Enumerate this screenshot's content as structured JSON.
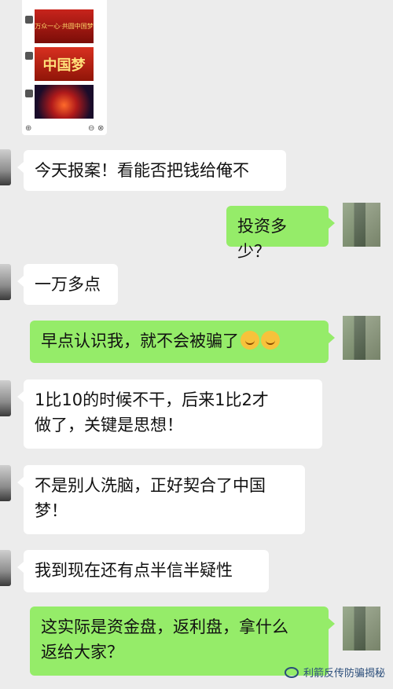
{
  "card": {
    "thumb1_text": "万众一心·共圆中国梦",
    "thumb2_text": "中国梦"
  },
  "messages": [
    {
      "side": "left",
      "text": "今天报案！看能否把钱给俺不"
    },
    {
      "side": "right",
      "text": "投资多少？"
    },
    {
      "side": "left",
      "text": "一万多点"
    },
    {
      "side": "right",
      "text": "早点认识我，就不会被骗了",
      "emojis": [
        "crying-laughing-emoji",
        "crying-laughing-emoji"
      ]
    },
    {
      "side": "left",
      "line1": "1比10的时候不干，后来1比2才",
      "line2": "做了，关键是思想！"
    },
    {
      "side": "left",
      "line1": "不是别人洗脑，正好契合了中国",
      "line2": "梦！"
    },
    {
      "side": "left",
      "text": "我到现在还有点半信半疑性"
    },
    {
      "side": "right",
      "line1": "这实际是资金盘，返利盘，拿什么",
      "line2": "返给大家？"
    }
  ],
  "watermark": {
    "text": "利箭反传防骗揭秘"
  },
  "colors": {
    "background": "#ececec",
    "self_bubble": "#95ec69",
    "other_bubble": "#ffffff"
  }
}
